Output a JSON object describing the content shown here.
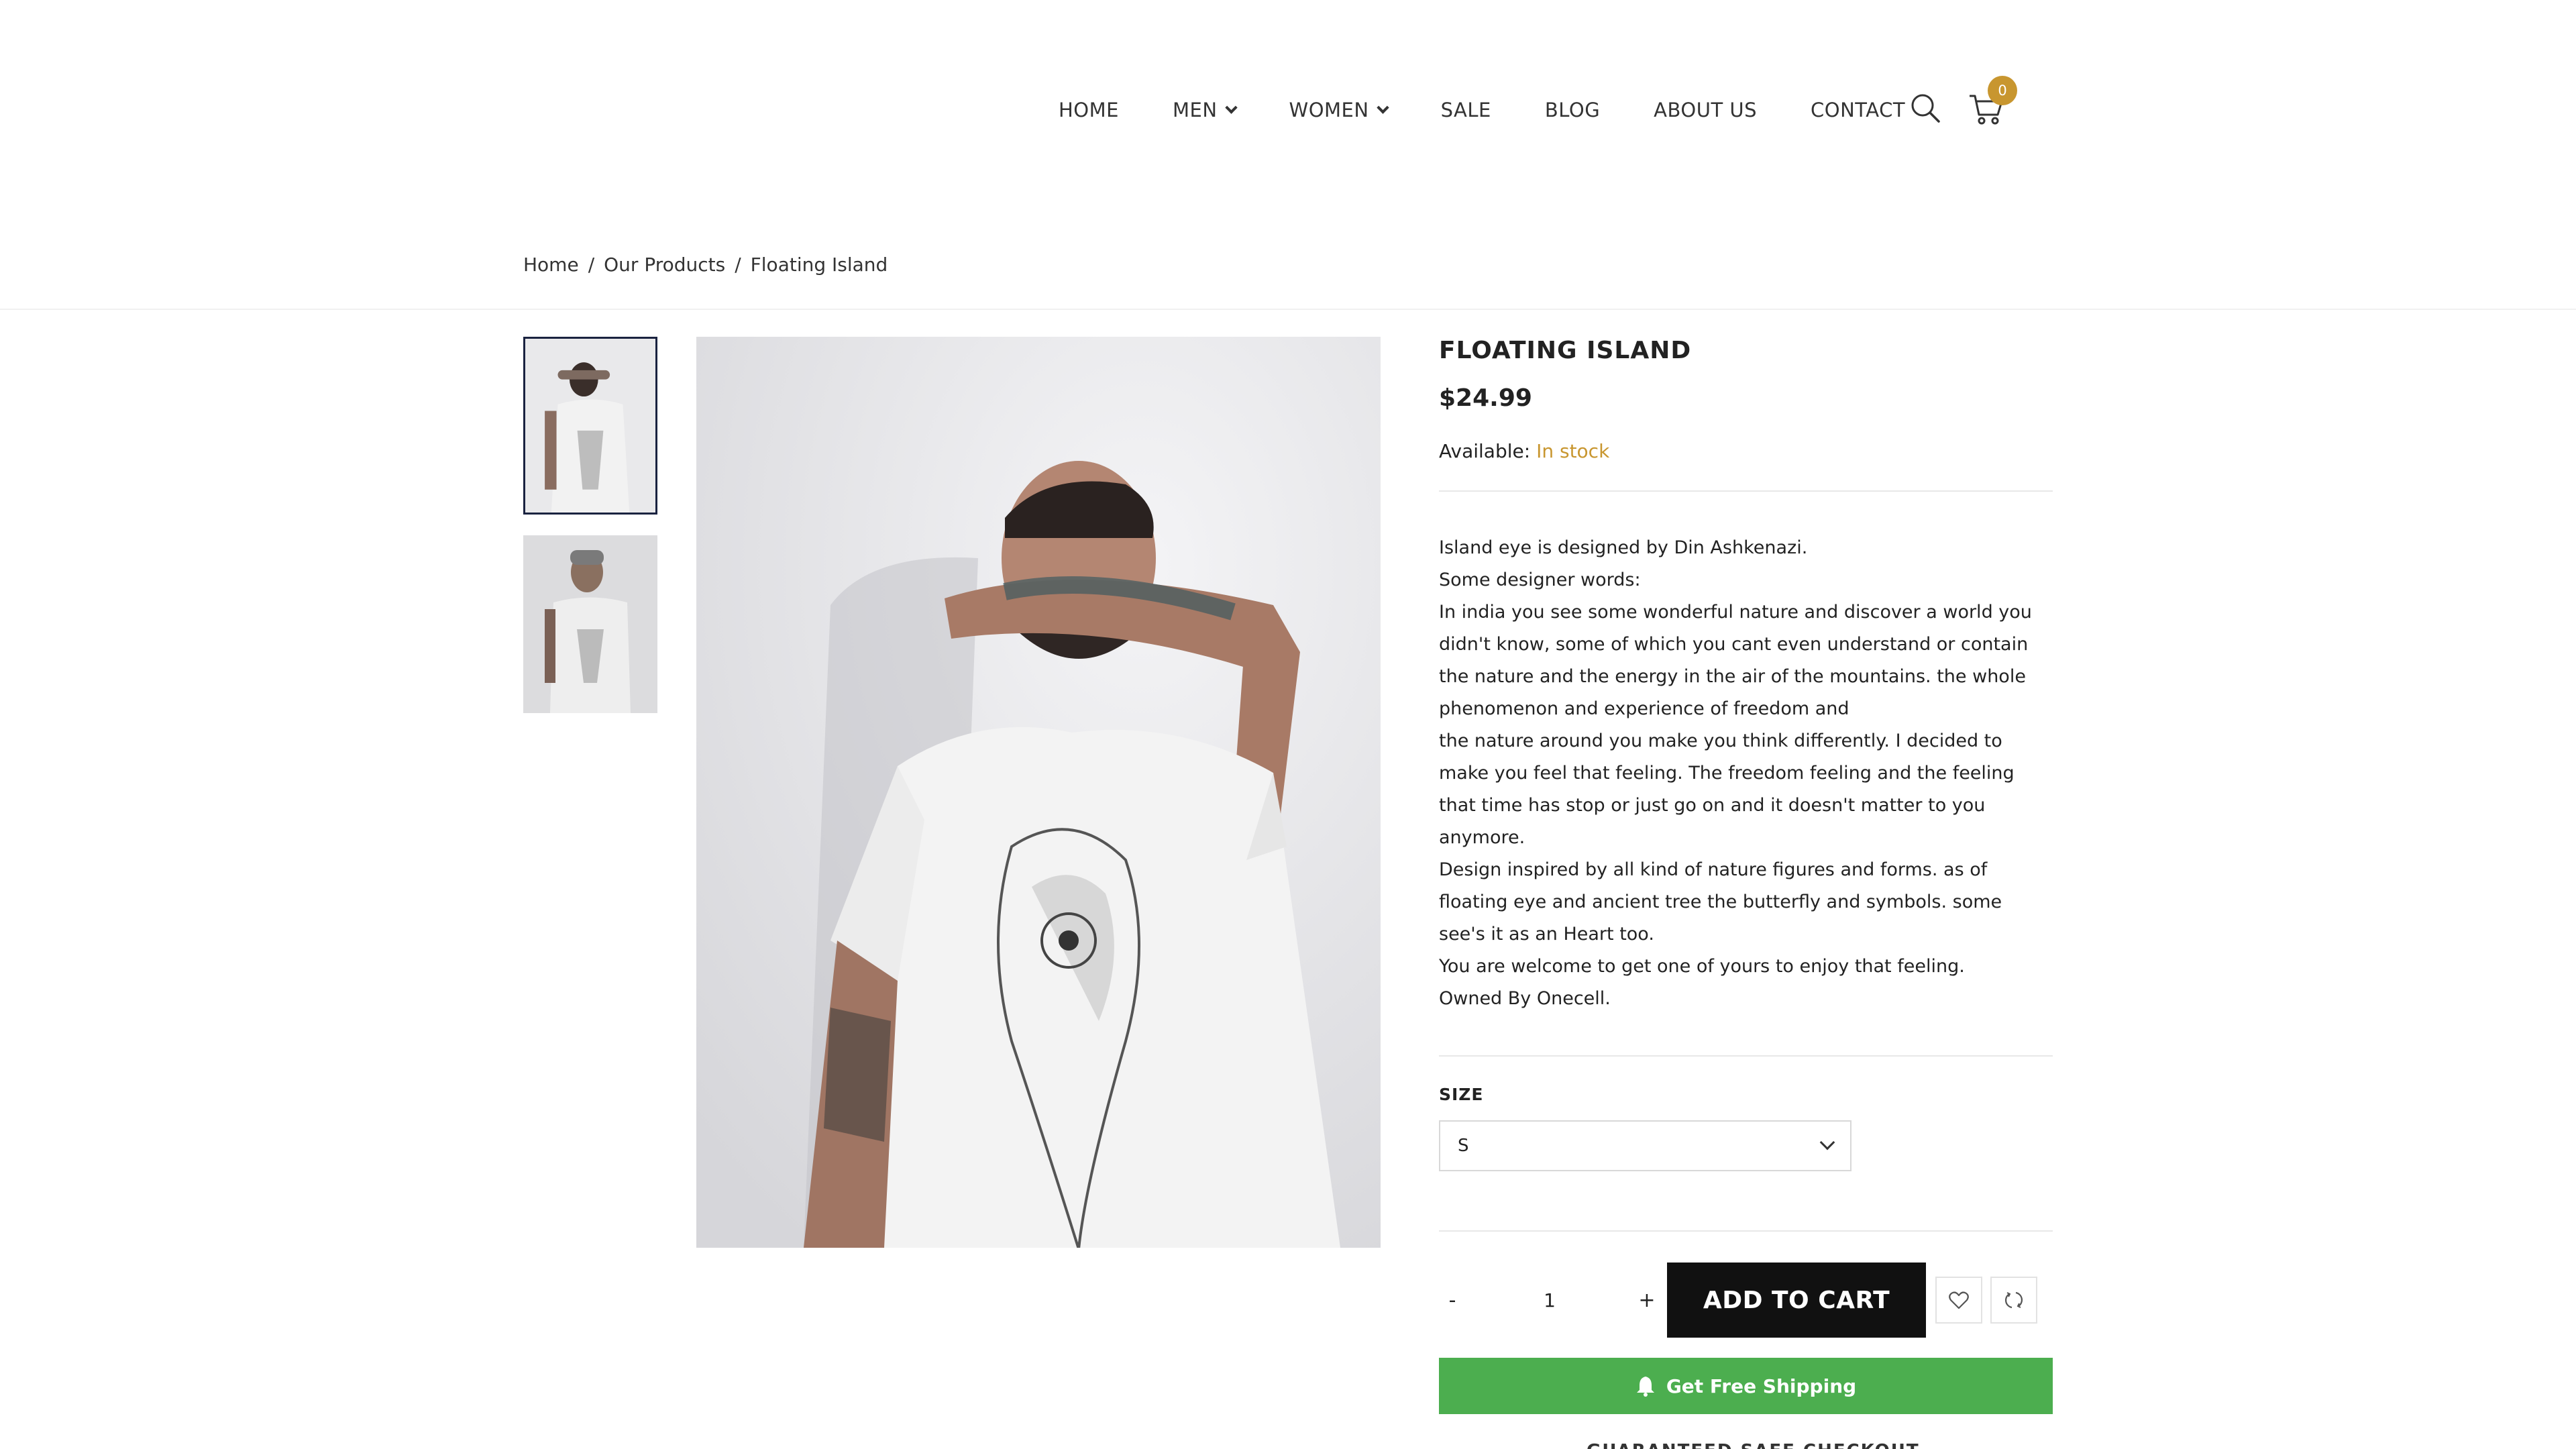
{
  "nav": {
    "items": [
      {
        "label": "HOME",
        "dropdown": false
      },
      {
        "label": "MEN",
        "dropdown": true
      },
      {
        "label": "WOMEN",
        "dropdown": true
      },
      {
        "label": "SALE",
        "dropdown": false
      },
      {
        "label": "BLOG",
        "dropdown": false
      },
      {
        "label": "ABOUT US",
        "dropdown": false
      },
      {
        "label": "CONTACT",
        "dropdown": false
      }
    ],
    "cart_count": "0"
  },
  "breadcrumb": {
    "items": [
      "Home",
      "Our Products",
      "Floating Island"
    ],
    "separator": "/"
  },
  "product": {
    "title": "FLOATING ISLAND",
    "price": "$24.99",
    "availability_label": "Available:",
    "availability_value": "In stock",
    "description": [
      "Island eye is designed by Din Ashkenazi.",
      "Some designer words:",
      "In india you see some wonderful nature and discover a world you didn't know, some of which you cant even understand or contain the nature and the energy in the air of the mountains. the whole phenomenon and experience of freedom and",
      "the nature around you make you think differently. I decided to make you feel that feeling. The freedom feeling and the feeling that time has stop or just go on and it doesn't matter to you anymore.",
      "Design inspired by all kind of nature figures and forms. as of floating eye and ancient tree the butterfly and symbols. some see's it as an Heart too.",
      "You are welcome to get one of yours to enjoy that feeling."
    ],
    "owned_by": "Owned By Onecell.",
    "size_label": "SIZE",
    "size_selected": "S",
    "qty_minus": "-",
    "qty_value": "1",
    "qty_plus": "+",
    "add_to_cart": "ADD TO CART",
    "free_shipping": "Get Free Shipping",
    "guarantee": "GUARANTEED SAFE CHECKOUT"
  },
  "colors": {
    "accent": "#c8962f",
    "shipping_green": "#4cae4f",
    "button_dark": "#111111"
  }
}
